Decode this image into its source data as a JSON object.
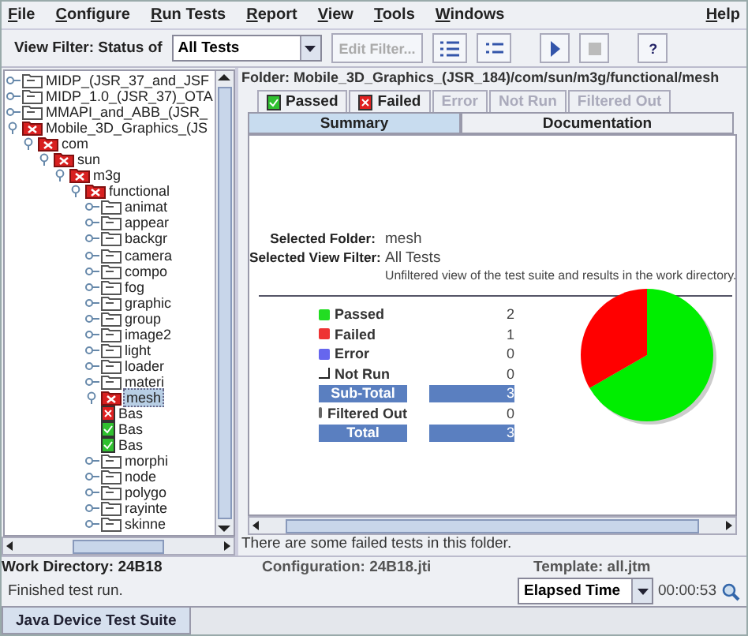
{
  "menu": {
    "items": [
      "File",
      "Configure",
      "Run Tests",
      "Report",
      "View",
      "Tools",
      "Windows"
    ],
    "help": "Help"
  },
  "toolbar": {
    "filter_label": "View Filter: Status of",
    "filter_value": "All Tests",
    "edit_filter": {
      "label": "Edit Filter...",
      "disabled": true
    },
    "help": "?"
  },
  "tree": [
    {
      "label": "MIDP_(JSR_37_and_JSF",
      "failed": false,
      "expanded": false
    },
    {
      "label": "MIDP_1.0_(JSR_37)_OTA",
      "failed": false,
      "expanded": false
    },
    {
      "label": "MMAPI_and_ABB_(JSR_",
      "failed": false,
      "expanded": false
    },
    {
      "label": "Mobile_3D_Graphics_(JS",
      "failed": true,
      "expanded": true,
      "children": [
        {
          "label": "com",
          "failed": true,
          "expanded": true,
          "children": [
            {
              "label": "sun",
              "failed": true,
              "expanded": true,
              "children": [
                {
                  "label": "m3g",
                  "failed": true,
                  "expanded": true,
                  "children": [
                    {
                      "label": "functional",
                      "failed": true,
                      "expanded": true,
                      "children": [
                        {
                          "label": "animat",
                          "failed": false,
                          "expanded": false
                        },
                        {
                          "label": "appear",
                          "failed": false,
                          "expanded": false
                        },
                        {
                          "label": "backgr",
                          "failed": false,
                          "expanded": false
                        },
                        {
                          "label": "camera",
                          "failed": false,
                          "expanded": false
                        },
                        {
                          "label": "compo",
                          "failed": false,
                          "expanded": false
                        },
                        {
                          "label": "fog",
                          "failed": false,
                          "expanded": false
                        },
                        {
                          "label": "graphic",
                          "failed": false,
                          "expanded": false
                        },
                        {
                          "label": "group",
                          "failed": false,
                          "expanded": false
                        },
                        {
                          "label": "image2",
                          "failed": false,
                          "expanded": false
                        },
                        {
                          "label": "light",
                          "failed": false,
                          "expanded": false
                        },
                        {
                          "label": "loader",
                          "failed": false,
                          "expanded": false
                        },
                        {
                          "label": "materi",
                          "failed": false,
                          "expanded": false
                        },
                        {
                          "label": "mesh",
                          "failed": true,
                          "expanded": true,
                          "selected": true,
                          "children": [
                            {
                              "label": "Bas",
                              "kind": "test",
                              "failed": true
                            },
                            {
                              "label": "Bas",
                              "kind": "test",
                              "failed": false
                            },
                            {
                              "label": "Bas",
                              "kind": "test",
                              "failed": false
                            }
                          ]
                        },
                        {
                          "label": "morphi",
                          "failed": false,
                          "expanded": false
                        },
                        {
                          "label": "node",
                          "failed": false,
                          "expanded": false
                        },
                        {
                          "label": "polygo",
                          "failed": false,
                          "expanded": false
                        },
                        {
                          "label": "rayinte",
                          "failed": false,
                          "expanded": false
                        },
                        {
                          "label": "skinne",
                          "failed": false,
                          "expanded": false
                        }
                      ]
                    }
                  ]
                }
              ]
            }
          ]
        }
      ]
    }
  ],
  "folder": "Folder: Mobile_3D_Graphics_(JSR_184)/com/sun/m3g/functional/mesh",
  "result_tabs": [
    {
      "label": "Passed",
      "kind": "passed",
      "disabled": false
    },
    {
      "label": "Failed",
      "kind": "failed",
      "disabled": false
    },
    {
      "label": "Error",
      "kind": "plain",
      "disabled": true
    },
    {
      "label": "Not Run",
      "kind": "plain",
      "disabled": true
    },
    {
      "label": "Filtered Out",
      "kind": "plain",
      "disabled": true
    }
  ],
  "view_tabs": [
    {
      "label": "Summary",
      "selected": true
    },
    {
      "label": "Documentation",
      "selected": false
    }
  ],
  "summary": {
    "folder_label": "Selected Folder:",
    "folder": "mesh",
    "filter_label": "Selected View Filter:",
    "filter": "All Tests",
    "filter_desc": "Unfiltered view of the test suite and results in the work directory."
  },
  "stats": [
    {
      "label": "Passed",
      "value": "2",
      "kind": "swatch",
      "color": "#22dd22"
    },
    {
      "label": "Failed",
      "value": "1",
      "kind": "swatch",
      "color": "#ee3333"
    },
    {
      "label": "Error",
      "value": "0",
      "kind": "swatch",
      "color": "#6666ee"
    },
    {
      "label": "Not Run",
      "value": "0",
      "kind": "notrun"
    },
    {
      "label": "Sub-Total",
      "value": "3",
      "kind": "total"
    },
    {
      "label": "Filtered Out",
      "value": "0",
      "kind": "swatch",
      "color": "#666666"
    },
    {
      "label": "Total",
      "value": "3",
      "kind": "total"
    }
  ],
  "chart_data": {
    "type": "pie",
    "values": [
      66.7,
      33.3
    ],
    "colors": [
      "#00ee00",
      "#ff0000"
    ]
  },
  "message": "There are some failed tests in this folder.",
  "work_directory": "Work Directory: 24B18",
  "configuration": "Configuration: 24B18.jti",
  "template": "Template: all.jtm",
  "status": "Finished test run.",
  "timer_select": "Elapsed Time",
  "elapsed": "00:00:53",
  "bottom_tab": "Java Device Test Suite"
}
